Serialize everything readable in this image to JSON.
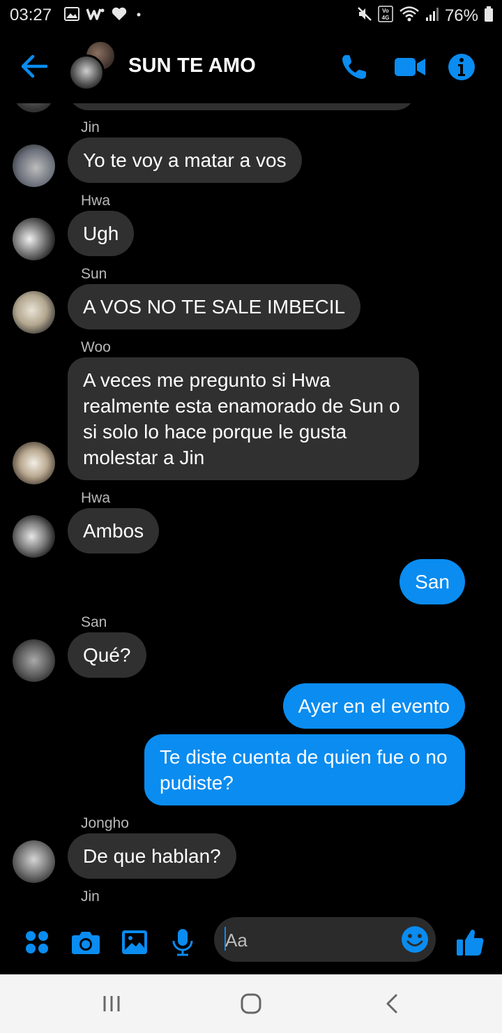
{
  "status_bar": {
    "time": "03:27",
    "battery": "76%",
    "left_icons": [
      "image-icon",
      "w-icon",
      "heart-icon",
      "dot-icon"
    ],
    "right_icons": [
      "mute-icon",
      "volte-icon",
      "wifi-icon",
      "signal-icon",
      "battery-icon"
    ],
    "volte_label": "Vo 4G"
  },
  "header": {
    "title": "SUN TE AMO",
    "accent": "#0a8cf0"
  },
  "messages": [
    {
      "sender": "Jin",
      "text": "Yo te voy a matar a vos",
      "direction": "in"
    },
    {
      "sender": "Hwa",
      "text": "Ugh",
      "direction": "in"
    },
    {
      "sender": "Sun",
      "text": "A VOS NO TE SALE IMBECIL",
      "direction": "in"
    },
    {
      "sender": "Woo",
      "text": "A veces me pregunto si Hwa realmente esta enamorado de Sun o si solo lo hace porque le gusta molestar a Jin",
      "direction": "in"
    },
    {
      "sender": "Hwa",
      "text": "Ambos",
      "direction": "in"
    },
    {
      "sender": "",
      "text": "San",
      "direction": "out"
    },
    {
      "sender": "San",
      "text": "Qué?",
      "direction": "in"
    },
    {
      "sender": "",
      "text": "Ayer en el evento",
      "direction": "out"
    },
    {
      "sender": "",
      "text": "Te diste cuenta de quien fue o no pudiste?",
      "direction": "out"
    },
    {
      "sender": "Jongho",
      "text": "De que hablan?",
      "direction": "in"
    },
    {
      "sender": "Jin",
      "text": "",
      "direction": "in"
    }
  ],
  "composer": {
    "placeholder": "Aa",
    "icons": [
      "apps-icon",
      "camera-icon",
      "gallery-icon",
      "microphone-icon",
      "emoji-icon",
      "like-icon"
    ]
  },
  "colors": {
    "incoming_bubble": "#303030",
    "outgoing_bubble": "#0a8cf0",
    "background": "#000000"
  }
}
